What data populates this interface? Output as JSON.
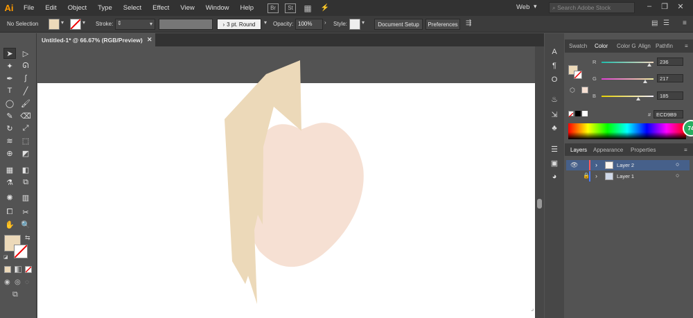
{
  "app": {
    "logo": "Ai"
  },
  "menu": [
    "File",
    "Edit",
    "Object",
    "Type",
    "Select",
    "Effect",
    "View",
    "Window",
    "Help"
  ],
  "menubar_icons": {
    "bridge": "Br",
    "stock": "St"
  },
  "workspace": {
    "label": "Web"
  },
  "search": {
    "placeholder": "Search Adobe Stock"
  },
  "control_bar": {
    "selection_label": "No Selection",
    "fill_color": "#ECD9B9",
    "stroke_label": "Stroke:",
    "brush": "3 pt. Round",
    "opacity_label": "Opacity:",
    "opacity_value": "100%",
    "style_label": "Style:",
    "doc_setup": "Document Setup",
    "preferences": "Preferences"
  },
  "document": {
    "tab_title": "Untitled-1* @ 66.67% (RGB/Preview)"
  },
  "tools": [
    "selection-tool",
    "direct-selection-tool",
    "magic-wand-tool",
    "lasso-tool",
    "pen-tool",
    "curvature-tool",
    "type-tool",
    "line-tool",
    "ellipse-tool",
    "paintbrush-tool",
    "shaper-tool",
    "eraser-tool",
    "rotate-tool",
    "scale-tool",
    "warp-tool",
    "free-transform-tool",
    "shape-builder-tool",
    "perspective-tool",
    "mesh-tool",
    "gradient-tool",
    "eyedropper-tool",
    "blend-tool",
    "symbol-sprayer-tool",
    "column-graph-tool",
    "artboard-tool",
    "slice-tool",
    "hand-tool",
    "zoom-tool"
  ],
  "color_panel": {
    "tabs": [
      "Swatch",
      "Color",
      "Color G",
      "Align",
      "Pathfin"
    ],
    "active_tab": "Color",
    "r_label": "R",
    "r": "236",
    "g_label": "G",
    "g": "217",
    "b_label": "B",
    "b": "185",
    "hex_label": "#",
    "hex": "ECD9B9",
    "r_fraction": 0.925,
    "g_fraction": 0.851,
    "b_fraction": 0.725
  },
  "layers_panel": {
    "tabs": [
      "Layers",
      "Appearance",
      "Properties"
    ],
    "layers": [
      {
        "name": "Layer 2",
        "color": "#ff5a5a",
        "selected": true
      },
      {
        "name": "Layer 1",
        "color": "#4a7bff",
        "selected": false
      }
    ]
  },
  "badge": {
    "value": "74"
  },
  "colors": {
    "peach": "#F6E0D3",
    "beige": "#ECD9B9",
    "accent": "#ff9a00"
  }
}
